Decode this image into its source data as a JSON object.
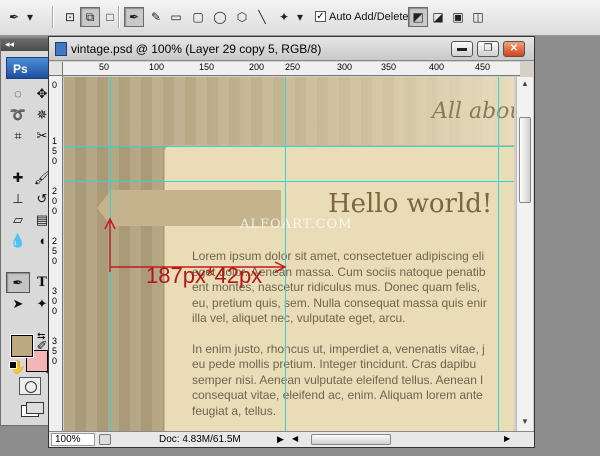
{
  "options_bar": {
    "auto_add_delete_label": "Auto Add/Delete",
    "auto_add_delete_checked": true
  },
  "tools_panel": {
    "logo": "Ps",
    "foreground_color": "#bdaa82",
    "background_color": "#f5b5b5"
  },
  "document": {
    "title": "vintage.psd @ 100% (Layer 29 copy 5, RGB/8)",
    "ruler_top_ticks": [
      "50",
      "100",
      "150",
      "200",
      "250",
      "300",
      "350",
      "400",
      "450"
    ],
    "ruler_left_ticks": [
      "0",
      "1",
      "5",
      "0",
      "2",
      "0",
      "0",
      "2",
      "5",
      "0",
      "3",
      "0",
      "0",
      "3",
      "5",
      "0"
    ],
    "canvas": {
      "tagline": "All abou",
      "heading": "Hello world!",
      "watermark": "ALFOART.COM",
      "measurement": "187px*42px",
      "paragraph_1_lines": [
        "Lorem ipsum dolor sit amet, consectetuer adipiscing eli",
        "eget dolor. Aenean massa. Cum sociis natoque penatib",
        "ent montes, nascetur ridiculus mus. Donec quam felis,",
        "eu, pretium quis, sem. Nulla consequat massa quis enir",
        "illa vel, aliquet nec, vulputate eget, arcu."
      ],
      "paragraph_2_lines": [
        "In enim justo, rhoncus ut, imperdiet a, venenatis vitae, j",
        "eu pede mollis pretium. Integer tincidunt. Cras dapibu",
        "semper nisi. Aenean vulputate eleifend tellus. Aenean l",
        "consequat vitae, eleifend ac, enim. Aliquam lorem ante",
        "feugiat a, tellus."
      ]
    },
    "status": {
      "zoom": "100%",
      "doc_info": "Doc: 4.83M/61.5M"
    }
  }
}
